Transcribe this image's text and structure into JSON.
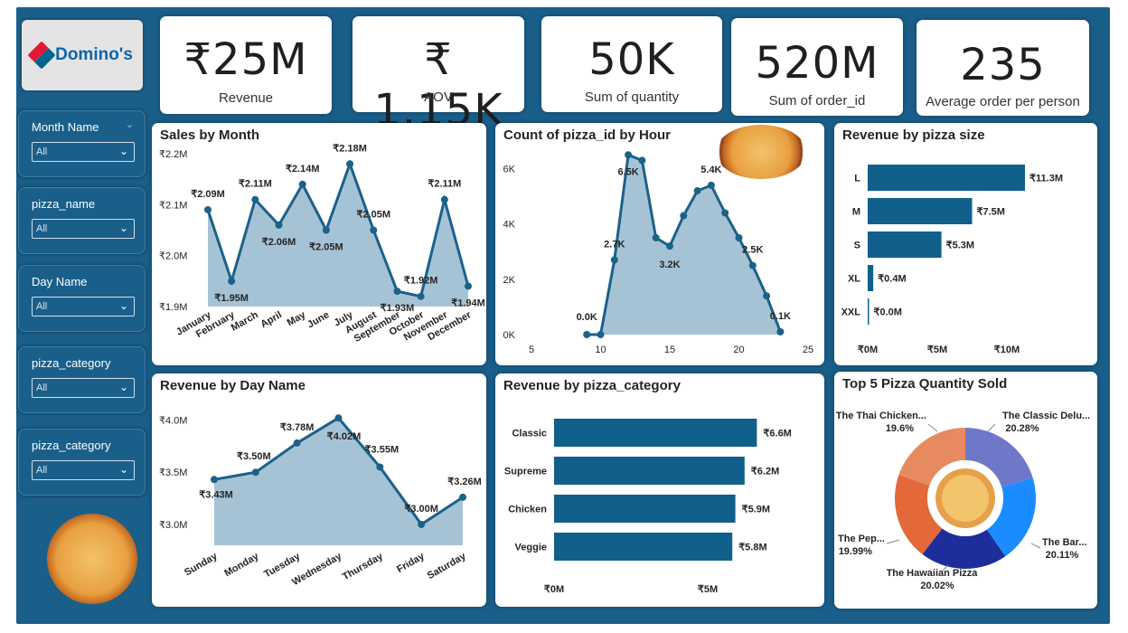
{
  "sidebar": {
    "logo_text": "Domino's",
    "slicers": [
      {
        "title": "Month Name",
        "value": "All"
      },
      {
        "title": "pizza_name",
        "value": "All"
      },
      {
        "title": "Day Name",
        "value": "All"
      },
      {
        "title": "pizza_category",
        "value": "All"
      },
      {
        "title": "pizza_category",
        "value": "All"
      }
    ]
  },
  "kpis": [
    {
      "value": "₹25M",
      "label": "Revenue"
    },
    {
      "value": "₹ 1.15K",
      "label": "AOV"
    },
    {
      "value": "50K",
      "label": "Sum of quantity"
    },
    {
      "value": "520M",
      "label": "Sum of order_id"
    },
    {
      "value": "235",
      "label": "Average order per person"
    }
  ],
  "colors": {
    "accent": "#1a5f8a",
    "bar": "#11608c",
    "area": "#a6c3d6",
    "line": "#1b6189"
  },
  "chart_data": [
    {
      "type": "area",
      "title": "Sales by Month",
      "categories": [
        "January",
        "February",
        "March",
        "April",
        "May",
        "June",
        "July",
        "August",
        "September",
        "October",
        "November",
        "December"
      ],
      "values": [
        2.09,
        1.95,
        2.11,
        2.06,
        2.14,
        2.05,
        2.18,
        2.05,
        1.93,
        1.92,
        2.11,
        1.94
      ],
      "labels": [
        "₹2.09M",
        "₹1.95M",
        "₹2.11M",
        "₹2.06M",
        "₹2.14M",
        "₹2.05M",
        "₹2.18M",
        "₹2.05M",
        "₹1.93M",
        "₹1.92M",
        "₹2.11M",
        "₹1.94M"
      ],
      "yticks": [
        "₹1.9M",
        "₹2.0M",
        "₹2.1M",
        "₹2.2M"
      ],
      "ylim": [
        1.9,
        2.2
      ]
    },
    {
      "type": "area",
      "title": "Count of pizza_id by Hour",
      "x": [
        9,
        10,
        11,
        12,
        13,
        14,
        15,
        16,
        17,
        18,
        19,
        20,
        21,
        22,
        23
      ],
      "values": [
        0.0,
        0.0,
        2.7,
        6.5,
        6.3,
        3.5,
        3.2,
        4.3,
        5.2,
        5.4,
        4.4,
        3.5,
        2.5,
        1.4,
        0.1
      ],
      "labels": {
        "9": "0.0K",
        "11": "2.7K",
        "12": "6.5K",
        "15": "3.2K",
        "18": "5.4K",
        "21": "2.5K",
        "23": "0.1K"
      },
      "xticks": [
        "5",
        "10",
        "15",
        "20",
        "25"
      ],
      "yticks": [
        "0K",
        "2K",
        "4K",
        "6K"
      ],
      "xlim": [
        5,
        25
      ],
      "ylim": [
        0,
        7
      ]
    },
    {
      "type": "bar",
      "title": "Revenue by pizza size",
      "categories": [
        "L",
        "M",
        "S",
        "XL",
        "XXL"
      ],
      "values": [
        11.3,
        7.5,
        5.3,
        0.4,
        0.0
      ],
      "labels": [
        "₹11.3M",
        "₹7.5M",
        "₹5.3M",
        "₹0.4M",
        "₹0.0M"
      ],
      "xticks": [
        "₹0M",
        "₹5M",
        "₹10M"
      ],
      "xlim": [
        0,
        15
      ]
    },
    {
      "type": "area",
      "title": "Revenue by Day Name",
      "categories": [
        "Sunday",
        "Monday",
        "Tuesday",
        "Wednesday",
        "Thursday",
        "Friday",
        "Saturday"
      ],
      "values": [
        3.43,
        3.5,
        3.78,
        4.02,
        3.55,
        3.0,
        3.26
      ],
      "labels": [
        "₹3.43M",
        "₹3.50M",
        "₹3.78M",
        "₹4.02M",
        "₹3.55M",
        "₹3.00M",
        "₹3.26M"
      ],
      "yticks": [
        "₹3.0M",
        "₹3.5M",
        "₹4.0M"
      ],
      "ylim": [
        2.8,
        4.1
      ]
    },
    {
      "type": "bar",
      "title": "Revenue by pizza_category",
      "categories": [
        "Classic",
        "Supreme",
        "Chicken",
        "Veggie"
      ],
      "values": [
        6.6,
        6.2,
        5.9,
        5.8
      ],
      "labels": [
        "₹6.6M",
        "₹6.2M",
        "₹5.9M",
        "₹5.8M"
      ],
      "xticks": [
        "₹0M",
        "₹5M"
      ],
      "xlim": [
        0,
        8
      ]
    },
    {
      "type": "pie",
      "title": "Top 5 Pizza Quantity Sold",
      "slices": [
        {
          "name": "The Classic Delu...",
          "pct_label": "20.28%",
          "value": 20.28,
          "color": "#6f78c8"
        },
        {
          "name": "The Bar...",
          "pct_label": "20.11%",
          "value": 20.11,
          "color": "#1a8cff"
        },
        {
          "name": "The Hawaiian Pizza",
          "pct_label": "20.02%",
          "value": 20.02,
          "color": "#1d2e9c"
        },
        {
          "name": "The Pep...",
          "pct_label": "19.99%",
          "value": 19.99,
          "color": "#e3683a"
        },
        {
          "name": "The Thai Chicken...",
          "pct_label": "19.6%",
          "value": 19.6,
          "color": "#e88a5f"
        }
      ]
    }
  ]
}
